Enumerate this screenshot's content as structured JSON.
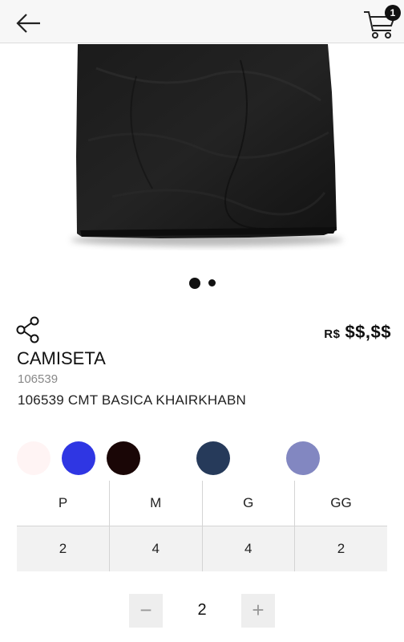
{
  "header": {
    "back_icon": "arrow-left-icon",
    "cart_icon": "cart-icon",
    "cart_count": "1"
  },
  "gallery": {
    "image": "black-tshirt",
    "pages": 2,
    "active_page": 1
  },
  "product": {
    "share_icon": "share-icon",
    "currency": "R$",
    "price": "$$,$$",
    "name": "CAMISETA",
    "code": "106539",
    "description": "106539 CMT BASICA KHAIRKHABN"
  },
  "colors": [
    "#fff4f4",
    "#2f36e3",
    "#1a0606",
    "#263a5a",
    "#8287c1"
  ],
  "sizes": {
    "labels": [
      "P",
      "M",
      "G",
      "GG"
    ],
    "quantities": [
      "2",
      "4",
      "4",
      "2"
    ]
  },
  "stepper": {
    "minus_label": "−",
    "value": "2",
    "plus_label": "+"
  }
}
